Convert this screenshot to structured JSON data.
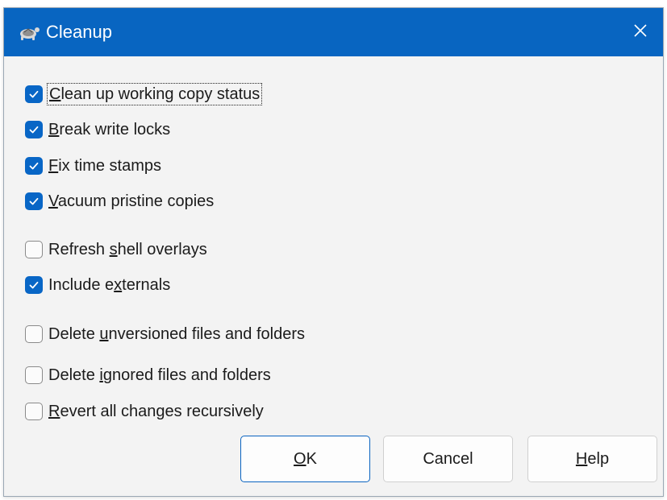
{
  "window": {
    "title": "Cleanup",
    "title_icon": "tortoise-icon",
    "close_icon": "close-icon"
  },
  "options": [
    {
      "pre": "",
      "key": "C",
      "post": "lean up working copy status",
      "checked": true
    },
    {
      "pre": "",
      "key": "B",
      "post": "reak write locks",
      "checked": true
    },
    {
      "pre": "",
      "key": "F",
      "post": "ix time stamps",
      "checked": true
    },
    {
      "pre": "",
      "key": "V",
      "post": "acuum pristine copies",
      "checked": true
    },
    {
      "pre": "Refresh ",
      "key": "s",
      "post": "hell overlays",
      "checked": false
    },
    {
      "pre": "Include e",
      "key": "x",
      "post": "ternals",
      "checked": true
    },
    {
      "pre": "Delete ",
      "key": "u",
      "post": "nversioned files and folders",
      "checked": false
    },
    {
      "pre": "Delete ",
      "key": "i",
      "post": "gnored files and folders",
      "checked": false
    },
    {
      "pre": "",
      "key": "R",
      "post": "evert all changes recursively",
      "checked": false
    }
  ],
  "buttons": {
    "ok": {
      "key": "O",
      "post": "K"
    },
    "cancel": {
      "label": "Cancel"
    },
    "help": {
      "key": "H",
      "post": "elp"
    }
  },
  "colors": {
    "titlebar": "#0865c1",
    "checkbox_checked": "#0866c6",
    "default_button_border": "#0a63c0"
  }
}
